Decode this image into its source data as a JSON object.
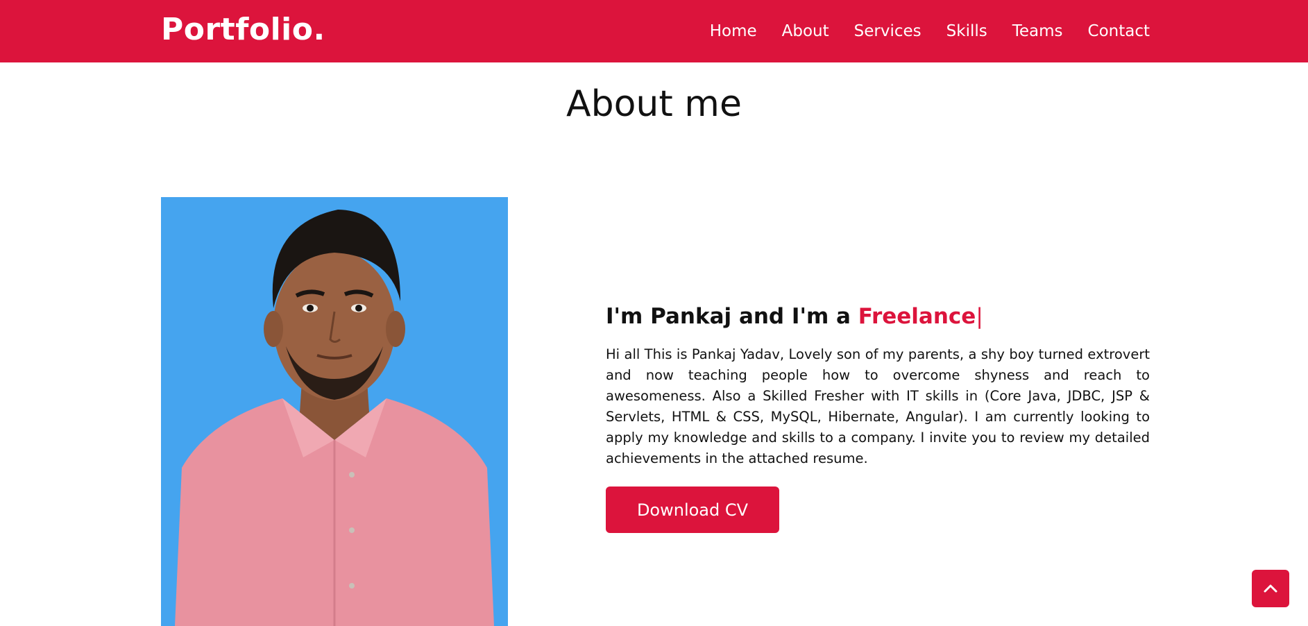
{
  "navbar": {
    "logo": "Portfolio.",
    "links": [
      "Home",
      "About",
      "Services",
      "Skills",
      "Teams",
      "Contact"
    ]
  },
  "about": {
    "title": "About me",
    "headline_prefix": "I'm Pankaj and I'm a ",
    "headline_typed": "Freelance",
    "typing_cursor": "|",
    "bio": "Hi all This is Pankaj Yadav, Lovely son of my parents, a shy boy turned extrovert and now teaching people how to overcome shyness and reach to awesomeness. Also a Skilled Fresher with IT skills in (Core Java, JDBC, JSP & Servlets, HTML & CSS, MySQL, Hibernate, Angular). I am currently looking to apply my knowledge and skills to a company. I invite you to review my detailed achievements in the attached resume.",
    "download_label": "Download CV"
  },
  "icons": {
    "scroll_top": "chevron-up-icon"
  },
  "colors": {
    "accent": "#dc143c",
    "photo_background": "#45a4ef",
    "shirt": "#e8929f"
  }
}
